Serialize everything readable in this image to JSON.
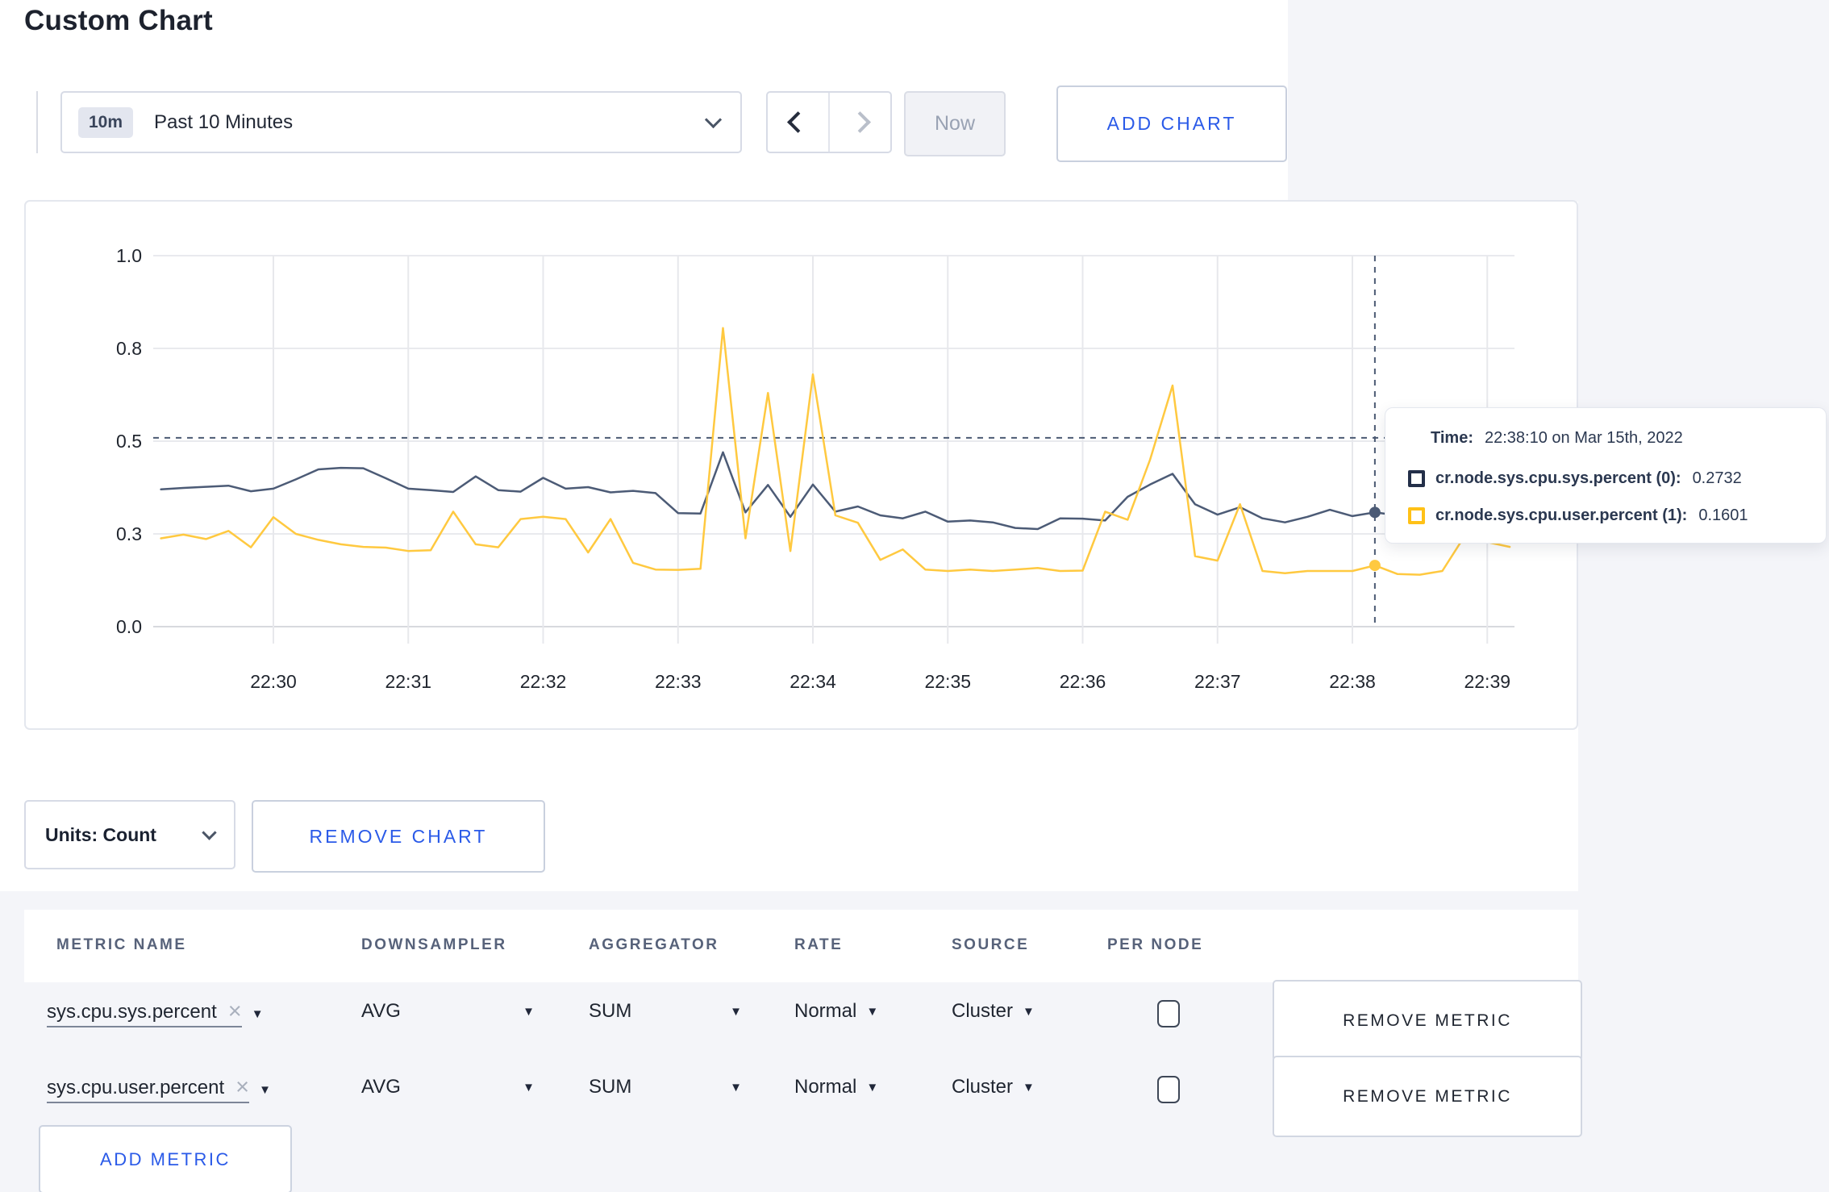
{
  "page": {
    "title": "Custom Chart"
  },
  "toolbar": {
    "range_badge": "10m",
    "range_label": "Past 10 Minutes",
    "now_label": "Now",
    "add_chart_label": "ADD CHART"
  },
  "chart_card": {
    "units_label": "Units: Count",
    "remove_chart_label": "REMOVE CHART"
  },
  "tooltip": {
    "time_label": "Time:",
    "time_value": "22:38:10 on Mar 15th, 2022",
    "series": [
      {
        "label": "cr.node.sys.cpu.sys.percent (0):",
        "value": "0.2732",
        "color": "#232f49"
      },
      {
        "label": "cr.node.sys.cpu.user.percent (1):",
        "value": "0.1601",
        "color": "#ffc117"
      }
    ]
  },
  "icons": {
    "remove_x": "×",
    "caret_down": "▼"
  },
  "metrics_table": {
    "headers": [
      "METRIC NAME",
      "DOWNSAMPLER",
      "AGGREGATOR",
      "RATE",
      "SOURCE",
      "PER NODE"
    ],
    "remove_metric_label": "REMOVE METRIC",
    "add_metric_label": "ADD METRIC",
    "rows": [
      {
        "name": "sys.cpu.sys.percent",
        "downsampler": "AVG",
        "aggregator": "SUM",
        "rate": "Normal",
        "source": "Cluster",
        "per_node": false
      },
      {
        "name": "sys.cpu.user.percent",
        "downsampler": "AVG",
        "aggregator": "SUM",
        "rate": "Normal",
        "source": "Cluster",
        "per_node": false
      }
    ]
  },
  "chart_data": {
    "type": "line",
    "title": "",
    "start_time": "22:29:10",
    "interval_seconds": 10,
    "x_tick_labels": [
      "22:30",
      "22:31",
      "22:32",
      "22:33",
      "22:34",
      "22:35",
      "22:36",
      "22:37",
      "22:38",
      "22:39"
    ],
    "y_ticks": [
      {
        "v": 0.0,
        "label": "0.0"
      },
      {
        "v": 0.25,
        "label": "0.3"
      },
      {
        "v": 0.5,
        "label": "0.5"
      },
      {
        "v": 0.75,
        "label": "0.8"
      },
      {
        "v": 1.0,
        "label": "1.0"
      }
    ],
    "ylim": [
      0,
      1
    ],
    "grid": true,
    "legend_position": "none",
    "series": [
      {
        "name": "cr.node.sys.cpu.sys.percent",
        "color": "#4c5b76",
        "values": [
          0.37,
          0.374,
          0.377,
          0.38,
          0.365,
          0.372,
          0.397,
          0.424,
          0.428,
          0.427,
          0.4,
          0.372,
          0.368,
          0.363,
          0.405,
          0.368,
          0.364,
          0.401,
          0.372,
          0.376,
          0.362,
          0.366,
          0.36,
          0.306,
          0.305,
          0.47,
          0.308,
          0.382,
          0.296,
          0.383,
          0.31,
          0.324,
          0.3,
          0.292,
          0.31,
          0.283,
          0.286,
          0.281,
          0.266,
          0.263,
          0.292,
          0.291,
          0.286,
          0.35,
          0.383,
          0.412,
          0.33,
          0.302,
          0.322,
          0.292,
          0.281,
          0.296,
          0.315,
          0.298,
          0.308,
          0.3,
          0.295,
          0.3,
          0.296,
          0.3,
          0.298
        ]
      },
      {
        "name": "cr.node.sys.cpu.user.percent",
        "color": "#ffc940",
        "values": [
          0.238,
          0.248,
          0.236,
          0.258,
          0.214,
          0.295,
          0.25,
          0.234,
          0.222,
          0.215,
          0.213,
          0.204,
          0.206,
          0.31,
          0.222,
          0.214,
          0.29,
          0.296,
          0.29,
          0.2,
          0.29,
          0.172,
          0.154,
          0.153,
          0.156,
          0.805,
          0.238,
          0.63,
          0.204,
          0.68,
          0.3,
          0.28,
          0.18,
          0.208,
          0.154,
          0.15,
          0.154,
          0.15,
          0.154,
          0.158,
          0.15,
          0.151,
          0.31,
          0.288,
          0.45,
          0.65,
          0.19,
          0.178,
          0.33,
          0.15,
          0.144,
          0.15,
          0.15,
          0.15,
          0.165,
          0.142,
          0.14,
          0.15,
          0.245,
          0.228,
          0.215
        ]
      }
    ],
    "crosshair": {
      "time": "22:38:10",
      "point_index": 54,
      "hline_value": 0.509,
      "readout": {
        "cr.node.sys.cpu.sys.percent": 0.2732,
        "cr.node.sys.cpu.user.percent": 0.1601
      }
    }
  }
}
